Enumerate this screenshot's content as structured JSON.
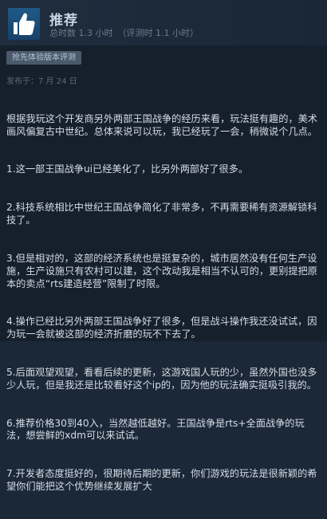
{
  "review": {
    "recommendation": "推荐",
    "hours_on_record": "总时数 1.3 小时",
    "hours_at_review": "（评测时 1.1 小时）",
    "early_access_badge": "抢先体验版本评测",
    "posted_date": "发布于：7 月 24 日",
    "paragraphs": [
      "根据我玩这个开发商另外两部王国战争的经历来看，玩法挺有趣的，美术画风偏复古中世纪。总体来说可以玩，我已经玩了一会，稍微说个几点。",
      "1.这一部王国战争ui已经美化了，比另外两部好了很多。",
      "2.科技系统相比中世纪王国战争简化了非常多，不再需要稀有资源解锁科技了。",
      "3.但是相对的，这部的经济系统也是挺复杂的，城市居然没有任何生产设施，生产设施只有农村可以建，这个改动我是相当不认可的，更别提把原本的卖点“rts建造经营”限制了时限。",
      "4.操作已经比另外两部王国战争好了很多，但是战斗操作我还没试试，因为玩一会就被这部的经济折磨的玩不下去了。",
      "5.后面观望观望，看看后续的更新，这游戏国人玩的少，虽然外国也没多少人玩，但是我还是比较看好这个ip的，因为他的玩法确实挺吸引我的。",
      "6.推荐价格30到40入，当然越低越好。王国战争是rts+全面战争的玩法，想尝鲜的xdm可以来试试。",
      "7.开发者态度挺好的，很期待后期的更新，你们游戏的玩法是很新颖的希望你们能把这个优势继续发展扩大"
    ]
  },
  "colors": {
    "background": "#16202d",
    "header": "#1f2d3e",
    "thumb_icon_bg": "#1e5a86",
    "title_text": "#c6d4df",
    "body_text": "#d5dde5",
    "muted_text": "#6a7c8d"
  },
  "icons": {
    "recommend_icon": "thumbs-up-icon"
  }
}
